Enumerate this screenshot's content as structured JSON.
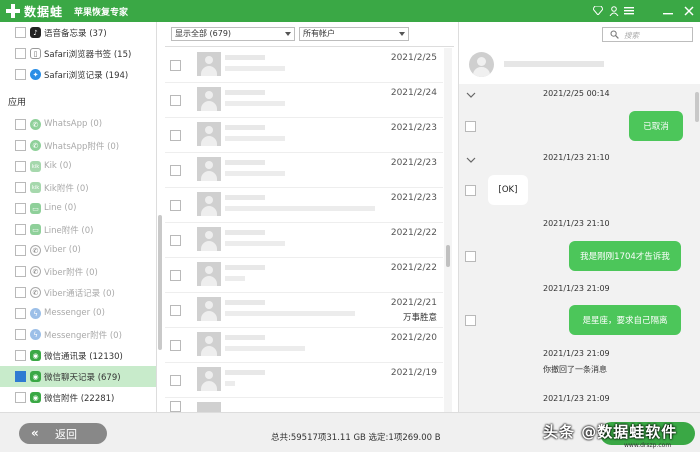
{
  "titlebar": {
    "app_name": "数据蛙",
    "subtitle": "苹果恢复专家",
    "controls": [
      "diamond-icon",
      "user-icon",
      "menu-icon",
      "minimize-icon",
      "close-icon"
    ]
  },
  "sidebar": {
    "top_items": [
      {
        "label": "语音备忘录 (37)",
        "icon": "voice-memo-icon"
      },
      {
        "label": "Safari浏览器书签 (15)",
        "icon": "bookmark-icon"
      },
      {
        "label": "Safari浏览记录 (194)",
        "icon": "safari-icon"
      }
    ],
    "section_title": "应用",
    "app_items": [
      {
        "label": "WhatsApp (0)",
        "icon": "whatsapp-icon",
        "disabled": true
      },
      {
        "label": "WhatsApp附件 (0)",
        "icon": "whatsapp-icon",
        "disabled": true
      },
      {
        "label": "Kik (0)",
        "icon": "kik-icon",
        "disabled": true
      },
      {
        "label": "Kik附件 (0)",
        "icon": "kik-icon",
        "disabled": true
      },
      {
        "label": "Line (0)",
        "icon": "line-icon",
        "disabled": true
      },
      {
        "label": "Line附件 (0)",
        "icon": "line-icon",
        "disabled": true
      },
      {
        "label": "Viber (0)",
        "icon": "viber-icon",
        "disabled": true
      },
      {
        "label": "Viber附件 (0)",
        "icon": "viber-icon",
        "disabled": true
      },
      {
        "label": "Viber通话记录 (0)",
        "icon": "viber-icon",
        "disabled": true
      },
      {
        "label": "Messenger (0)",
        "icon": "messenger-icon",
        "disabled": true
      },
      {
        "label": "Messenger附件 (0)",
        "icon": "messenger-icon",
        "disabled": true
      },
      {
        "label": "微信通讯录 (12130)",
        "icon": "wechat-icon",
        "disabled": false
      },
      {
        "label": "微信聊天记录 (679)",
        "icon": "wechat-icon",
        "disabled": false,
        "active": true
      },
      {
        "label": "微信附件 (22281)",
        "icon": "wechat-icon",
        "disabled": false
      }
    ]
  },
  "list": {
    "filter_show": "显示全部 (679)",
    "filter_account": "所有帐户",
    "rows": [
      {
        "date": "2021/2/25",
        "snippet": ""
      },
      {
        "date": "2021/2/24",
        "snippet": ""
      },
      {
        "date": "2021/2/23",
        "snippet": ""
      },
      {
        "date": "2021/2/23",
        "snippet": ""
      },
      {
        "date": "2021/2/23",
        "snippet": ""
      },
      {
        "date": "2021/2/22",
        "snippet": ""
      },
      {
        "date": "2021/2/22",
        "snippet": ""
      },
      {
        "date": "2021/2/21",
        "snippet": "万事胜意"
      },
      {
        "date": "2021/2/20",
        "snippet": ""
      },
      {
        "date": "2021/2/19",
        "snippet": ""
      },
      {
        "date": "",
        "snippet": ""
      }
    ]
  },
  "chat": {
    "search_placeholder": "搜索",
    "messages": {
      "ts1": "2021/2/25 00:14",
      "b1": "已取消",
      "ts2": "2021/1/23 21:10",
      "b2": "[OK]",
      "ts3": "2021/1/23 21:10",
      "b3": "我是刚刚1704才告诉我",
      "ts4": "2021/1/23 21:09",
      "b4": "是星座，要求自己隔离",
      "ts5": "2021/1/23 21:09",
      "m5": "你撤回了一条消息",
      "ts6": "2021/1/23 21:09"
    }
  },
  "bottom": {
    "back_label": "返回",
    "status": "总共:59517项31.11 GB 选定:1项269.00 B",
    "watermark": "头条 @数据蛙软件",
    "watermark_url": "www.drszp.com"
  },
  "colors": {
    "brand_green": "#3aa845",
    "bubble_green": "#4cc65a",
    "active_bg": "#c8ebcb"
  }
}
